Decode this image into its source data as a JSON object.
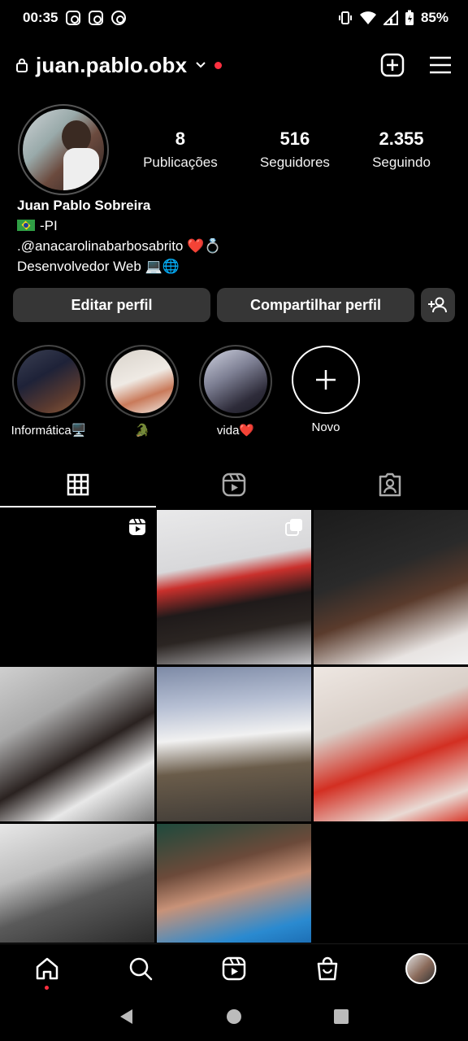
{
  "status_bar": {
    "time": "00:35",
    "battery": "85%"
  },
  "header": {
    "username": "juan.pablo.obx"
  },
  "profile": {
    "stats": [
      {
        "value": "8",
        "label": "Publicações"
      },
      {
        "value": "516",
        "label": "Seguidores"
      },
      {
        "value": "2.355",
        "label": "Seguindo"
      }
    ],
    "name": "Juan Pablo Sobreira",
    "bio_line1": "-PI",
    "bio_line2": ".@anacarolinabarbosabrito ❤️💍",
    "bio_line3": "Desenvolvedor Web 💻🌐"
  },
  "buttons": {
    "edit": "Editar perfil",
    "share": "Compartilhar perfil"
  },
  "highlights": [
    {
      "label": "Informática🖥️"
    },
    {
      "label": "🐊"
    },
    {
      "label": "vida❤️"
    },
    {
      "label": "Novo"
    }
  ],
  "colors": {
    "accent_red": "#ff3040",
    "button_bg": "#363636"
  }
}
